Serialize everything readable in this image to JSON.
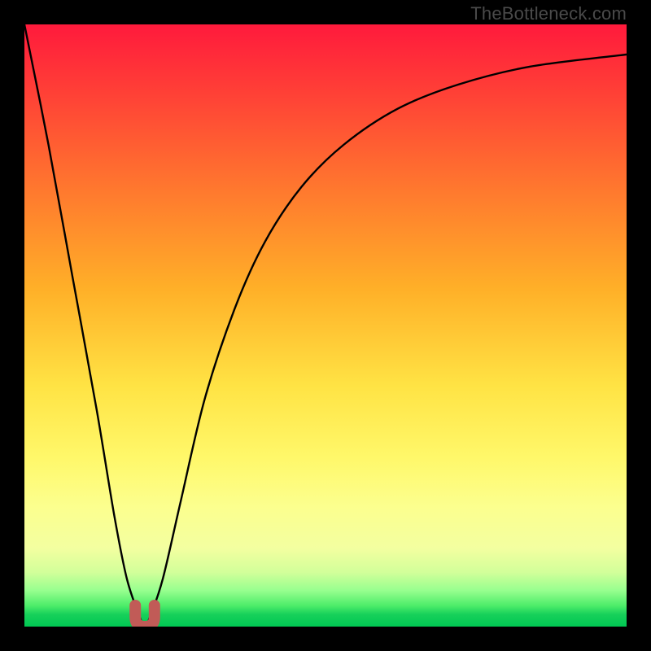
{
  "watermark": "TheBottleneck.com",
  "chart_data": {
    "type": "line",
    "title": "",
    "xlabel": "",
    "ylabel": "",
    "xlim": [
      0,
      100
    ],
    "ylim": [
      0,
      100
    ],
    "grid": false,
    "legend": null,
    "series": [
      {
        "name": "bottleneck-curve",
        "x": [
          0,
          4,
          8,
          12,
          15,
          17,
          19,
          20,
          21,
          23,
          26,
          30,
          35,
          40,
          46,
          53,
          62,
          72,
          84,
          100
        ],
        "y": [
          100,
          80,
          58,
          36,
          18,
          8,
          2,
          0,
          2,
          8,
          21,
          38,
          53,
          64,
          73,
          80,
          86,
          90,
          93,
          95
        ]
      }
    ],
    "notch": {
      "x": 20,
      "y": 0,
      "radius_pct": 1.6
    },
    "gradient_stops": [
      {
        "pos": 0.0,
        "color": "#ff1a3c"
      },
      {
        "pos": 0.12,
        "color": "#ff4236"
      },
      {
        "pos": 0.28,
        "color": "#ff7a2e"
      },
      {
        "pos": 0.44,
        "color": "#ffb028"
      },
      {
        "pos": 0.6,
        "color": "#ffe344"
      },
      {
        "pos": 0.72,
        "color": "#fff86a"
      },
      {
        "pos": 0.8,
        "color": "#fcff8e"
      },
      {
        "pos": 0.87,
        "color": "#f3ffa0"
      },
      {
        "pos": 0.91,
        "color": "#d2ff9a"
      },
      {
        "pos": 0.94,
        "color": "#97ff8f"
      },
      {
        "pos": 0.965,
        "color": "#4eed6a"
      },
      {
        "pos": 0.98,
        "color": "#17d05a"
      },
      {
        "pos": 1.0,
        "color": "#00c853"
      }
    ],
    "notch_color": "#c15b57"
  }
}
